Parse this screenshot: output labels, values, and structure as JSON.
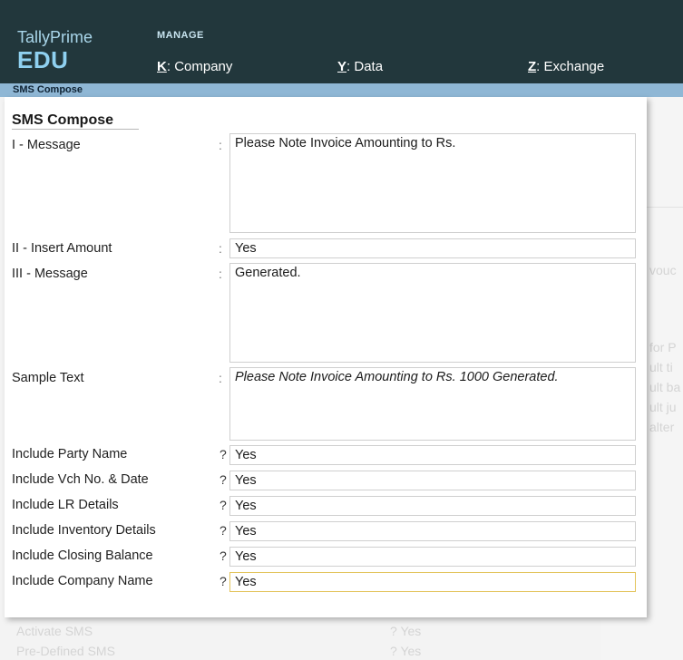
{
  "app": {
    "brand_line1": "TallyPrime",
    "brand_line2": "EDU"
  },
  "menu": {
    "section_label": "MANAGE",
    "items": [
      {
        "key": "K",
        "label": "Company"
      },
      {
        "key": "Y",
        "label": "Data"
      },
      {
        "key": "Z",
        "label": "Exchange"
      }
    ]
  },
  "subbar": {
    "title": "SMS Compose"
  },
  "background": {
    "frag_vouch": "vouc",
    "frag_forP": "for P",
    "frag_ltti": "ult ti",
    "frag_ltba": "ult ba",
    "frag_ltju": "ult ju",
    "frag_alter": "alter",
    "row_activate_label": "Activate SMS",
    "row_activate_value": "Yes",
    "row_predefined_label": "Pre-Defined SMS",
    "row_predefined_value": "Yes"
  },
  "dialog": {
    "title": "SMS Compose",
    "fields": {
      "message1": {
        "label": "I - Message",
        "sep": ":",
        "value": "Please Note Invoice Amounting to Rs."
      },
      "insert_amount": {
        "label": "II - Insert Amount",
        "sep": ":",
        "value": "Yes"
      },
      "message3": {
        "label": "III - Message",
        "sep": ":",
        "value": "Generated."
      },
      "sample_text": {
        "label": "Sample Text",
        "sep": ":",
        "value": "Please Note Invoice Amounting to Rs. 1000 Generated."
      },
      "party_name": {
        "label": "Include Party Name",
        "sep": "?",
        "value": "Yes"
      },
      "vch_no_date": {
        "label": "Include Vch No. & Date",
        "sep": "?",
        "value": "Yes"
      },
      "lr_details": {
        "label": "Include LR Details",
        "sep": "?",
        "value": "Yes"
      },
      "inventory_details": {
        "label": "Include Inventory Details",
        "sep": "?",
        "value": "Yes"
      },
      "closing_balance": {
        "label": "Include Closing Balance",
        "sep": "?",
        "value": "Yes"
      },
      "company_name": {
        "label": "Include Company Name",
        "sep": "?",
        "value": "Yes"
      }
    }
  }
}
